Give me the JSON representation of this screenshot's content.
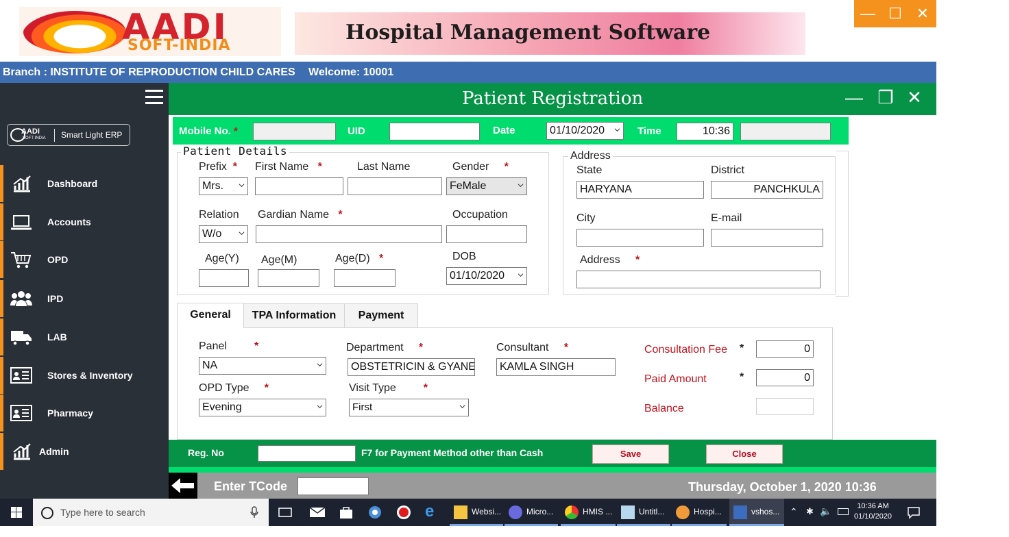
{
  "banner": {
    "logo_main": "AADI",
    "logo_sub": "SOFT-INDIA",
    "product_title": "Hospital Management Software"
  },
  "branch_bar": {
    "branch": "Branch : INSTITUTE OF REPRODUCTION  CHILD CARES",
    "welcome": "Welcome: 10001"
  },
  "sidebar": {
    "badge_logo": "AADI",
    "badge_logo_sub": "SOFT-INDIA",
    "badge_text": "Smart Light ERP",
    "items": [
      {
        "label": "Dashboard",
        "icon": "bar-chart-icon"
      },
      {
        "label": "Accounts",
        "icon": "laptop-icon"
      },
      {
        "label": "OPD",
        "icon": "cart-icon"
      },
      {
        "label": "IPD",
        "icon": "people-icon"
      },
      {
        "label": "LAB",
        "icon": "truck-icon"
      },
      {
        "label": "Stores & Inventory",
        "icon": "id-card-icon"
      },
      {
        "label": "Pharmacy",
        "icon": "id-card-icon"
      },
      {
        "label": "Admin",
        "icon": "bar-chart-icon"
      }
    ]
  },
  "form": {
    "title": "Patient Registration",
    "top": {
      "mobile_label": "Mobile No.",
      "mobile_value": "",
      "uid_label": "UID",
      "uid_value": "",
      "date_label": "Date",
      "date_value": "01/10/2020",
      "time_label": "Time",
      "time_value": "10:36",
      "extra_value": ""
    },
    "patient_details": {
      "title": "Patient Details",
      "prefix_label": "Prefix",
      "prefix_value": "Mrs.",
      "first_name_label": "First Name",
      "first_name_value": "",
      "last_name_label": "Last Name",
      "last_name_value": "",
      "gender_label": "Gender",
      "gender_value": "FeMale",
      "relation_label": "Relation",
      "relation_value": "W/o",
      "guardian_label": "Gardian Name",
      "guardian_value": "",
      "occupation_label": "Occupation",
      "occupation_value": "",
      "age_y_label": "Age(Y)",
      "age_m_label": "Age(M)",
      "age_d_label": "Age(D)",
      "dob_label": "DOB",
      "dob_value": "01/10/2020"
    },
    "address": {
      "title": "Address",
      "state_label": "State",
      "state_value": "HARYANA",
      "district_label": "District",
      "district_value": "PANCHKULA",
      "city_label": "City",
      "city_value": "",
      "email_label": "E-mail",
      "email_value": "",
      "address_label": "Address",
      "address_value": ""
    },
    "tabs": [
      {
        "label": "General",
        "active": true
      },
      {
        "label": "TPA Information",
        "active": false
      },
      {
        "label": "Payment",
        "active": false
      }
    ],
    "general": {
      "panel_label": "Panel",
      "panel_value": "NA",
      "department_label": "Department",
      "department_value": "OBSTETRICIN & GYANE",
      "consultant_label": "Consultant",
      "consultant_value": "KAMLA SINGH",
      "opd_type_label": "OPD Type",
      "opd_type_value": "Evening",
      "visit_type_label": "Visit Type",
      "visit_type_value": "First",
      "consultation_fee_label": "Consultation Fee",
      "consultation_fee_value": "0",
      "paid_amount_label": "Paid Amount",
      "paid_amount_value": "0",
      "balance_label": "Balance",
      "balance_value": ""
    },
    "actions": {
      "reg_no_label": "Reg. No",
      "reg_no_value": "",
      "hint": "F7 for Payment  Method other than Cash",
      "save_label": "Save",
      "close_label": "Close"
    },
    "required_mark": "*"
  },
  "tcode_bar": {
    "label": "Enter TCode",
    "value": "",
    "datetime": "Thursday, October 1, 2020   10:36"
  },
  "taskbar": {
    "search_placeholder": "Type here to search",
    "apps": [
      {
        "label": "Websi..."
      },
      {
        "label": "Micro..."
      },
      {
        "label": "HMIS ..."
      },
      {
        "label": "Untitl..."
      },
      {
        "label": "Hospi..."
      },
      {
        "label": "vshos..."
      }
    ],
    "tray_time": "10:36 AM",
    "tray_date": "01/10/2020"
  },
  "colors": {
    "header_green": "#069247",
    "bright_green": "#00dc6e",
    "sidebar_bg": "#2a3038",
    "accent_orange": "#f5921e",
    "branch_blue": "#3f6db1",
    "required_red": "#c0121c"
  }
}
